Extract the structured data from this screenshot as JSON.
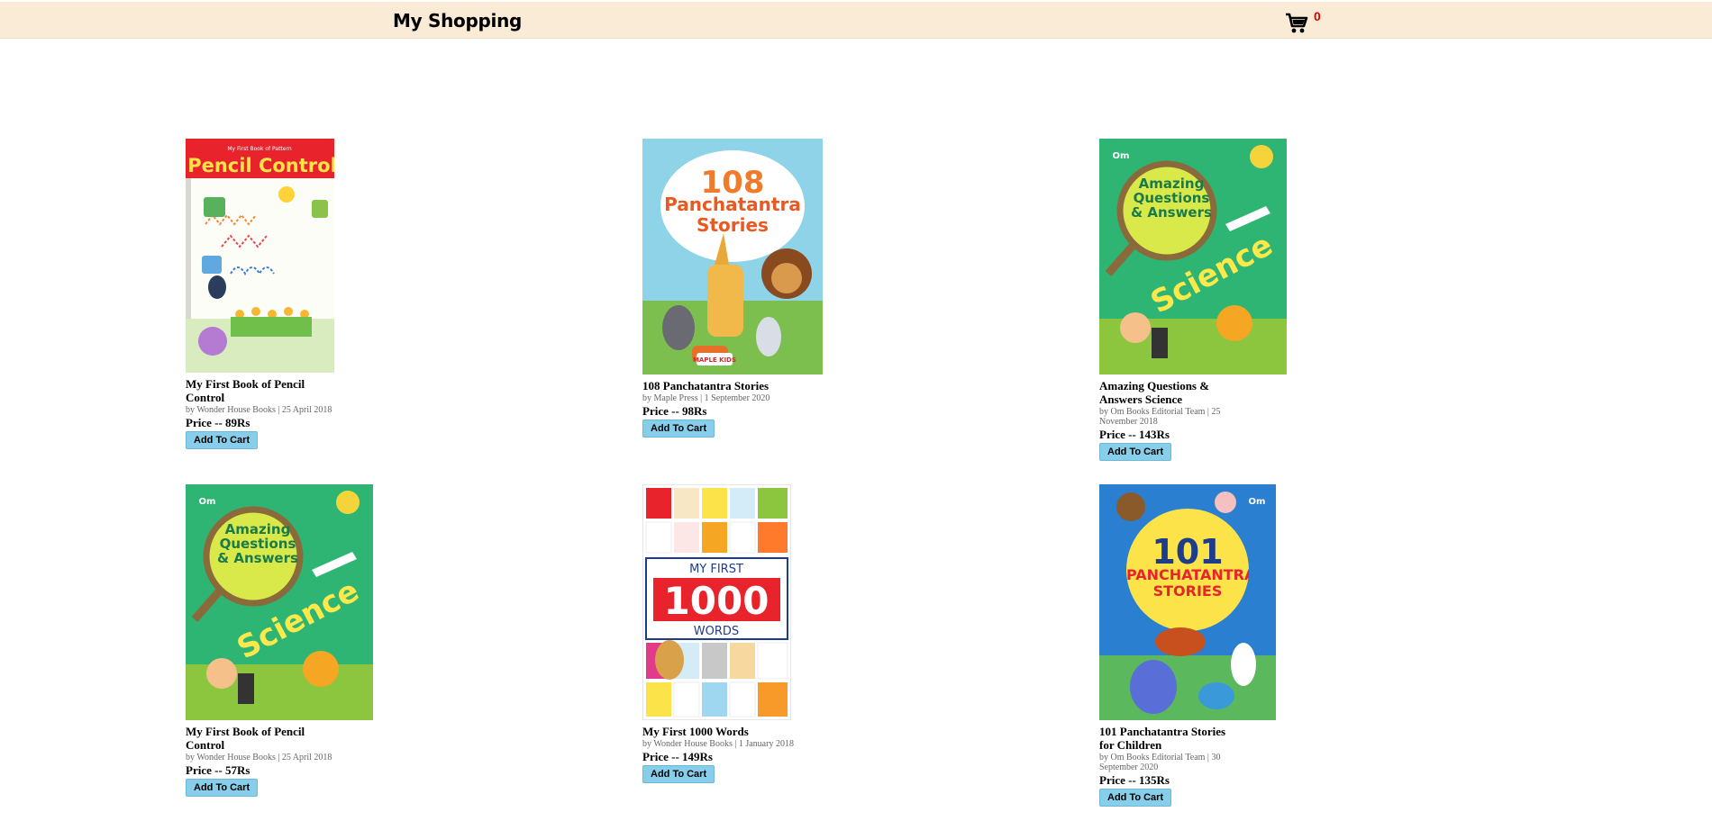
{
  "header": {
    "brand": "My Shopping",
    "cart_count": "0"
  },
  "products": [
    {
      "title": "My First Book of Pencil Control",
      "meta": "by Wonder House Books | 25 April 2018",
      "price": "Price -- 89Rs",
      "button": "Add To Cart",
      "cover_text": "Pencil Control",
      "cover_small": "My First Book of Pattern"
    },
    {
      "title": "108 Panchatantra Stories",
      "meta": "by Maple Press | 1 September 2020",
      "price": "Price -- 98Rs",
      "button": "Add To Cart",
      "cover_text": "108",
      "cover_sub": "Panchatantra Stories",
      "cover_badge": "MAPLE KIDS"
    },
    {
      "title": "Amazing Questions & Answers Science",
      "meta": "by Om Books Editorial Team | 25 November 2018",
      "price": "Price -- 143Rs",
      "button": "Add To Cart",
      "cover_text": "Amazing Questions & Answers",
      "cover_sub": "Science",
      "cover_badge": "Om"
    },
    {
      "title": "My First Book of Pencil Control",
      "meta": "by Wonder House Books | 25 April 2018",
      "price": "Price -- 57Rs",
      "button": "Add To Cart",
      "cover_text": "Amazing Questions & Answers",
      "cover_sub": "Science",
      "cover_badge": "Om"
    },
    {
      "title": "My First 1000 Words",
      "meta": "by Wonder House Books | 1 January 2018",
      "price": "Price -- 149Rs",
      "button": "Add To Cart",
      "cover_text": "MY FIRST",
      "cover_num": "1000",
      "cover_sub": "WORDS"
    },
    {
      "title": "101 Panchatantra Stories for Children",
      "meta": "by Om Books Editorial Team | 30 September 2020",
      "price": "Price -- 135Rs",
      "button": "Add To Cart",
      "cover_text": "101",
      "cover_sub": "PANCHATANTRA STORIES",
      "cover_badge": "Om"
    }
  ]
}
